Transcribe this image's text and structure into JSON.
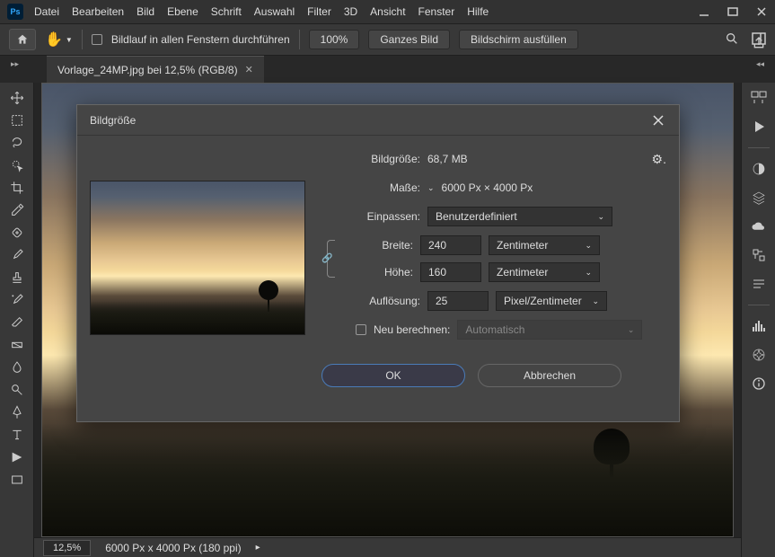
{
  "menu": {
    "items": [
      "Datei",
      "Bearbeiten",
      "Bild",
      "Ebene",
      "Schrift",
      "Auswahl",
      "Filter",
      "3D",
      "Ansicht",
      "Fenster",
      "Hilfe"
    ]
  },
  "optbar": {
    "scroll_all": "Bildlauf in allen Fenstern durchführen",
    "zoom": "100%",
    "fit": "Ganzes Bild",
    "fill": "Bildschirm ausfüllen"
  },
  "doc_tab": {
    "title": "Vorlage_24MP.jpg bei 12,5% (RGB/8)"
  },
  "status": {
    "zoom": "12,5%",
    "info": "6000 Px x 4000 Px (180 ppi)"
  },
  "dialog": {
    "title": "Bildgröße",
    "size_label": "Bildgröße:",
    "size_value": "68,7 MB",
    "dims_label": "Maße:",
    "dims_value": "6000 Px  ×  4000 Px",
    "fit_label": "Einpassen:",
    "fit_value": "Benutzerdefiniert",
    "width_label": "Breite:",
    "width_value": "240",
    "width_unit": "Zentimeter",
    "height_label": "Höhe:",
    "height_value": "160",
    "height_unit": "Zentimeter",
    "res_label": "Auflösung:",
    "res_value": "25",
    "res_unit": "Pixel/Zentimeter",
    "resample_label": "Neu berechnen:",
    "resample_value": "Automatisch",
    "ok": "OK",
    "cancel": "Abbrechen"
  }
}
